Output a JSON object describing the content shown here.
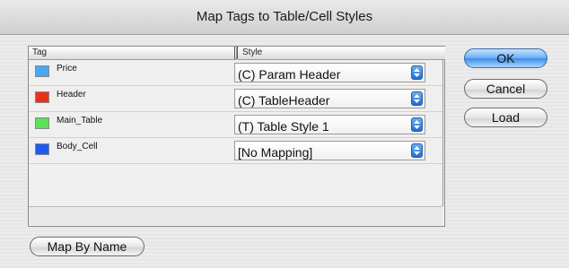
{
  "window": {
    "title": "Map Tags to Table/Cell Styles"
  },
  "table": {
    "headers": {
      "tag": "Tag",
      "style": "Style"
    },
    "rows": [
      {
        "tag": "Price",
        "style": "(C) Param Header",
        "color": "#4aa6ef"
      },
      {
        "tag": "Header",
        "style": "(C) TableHeader",
        "color": "#e8311c"
      },
      {
        "tag": "Main_Table",
        "style": "(T) Table Style 1",
        "color": "#5fe05a"
      },
      {
        "tag": "Body_Cell",
        "style": "[No Mapping]",
        "color": "#1f5bf0"
      }
    ]
  },
  "buttons": {
    "ok": "OK",
    "cancel": "Cancel",
    "load": "Load",
    "map_by_name": "Map By Name"
  },
  "icons": {
    "select_arrows": "up-down-arrows-icon"
  }
}
